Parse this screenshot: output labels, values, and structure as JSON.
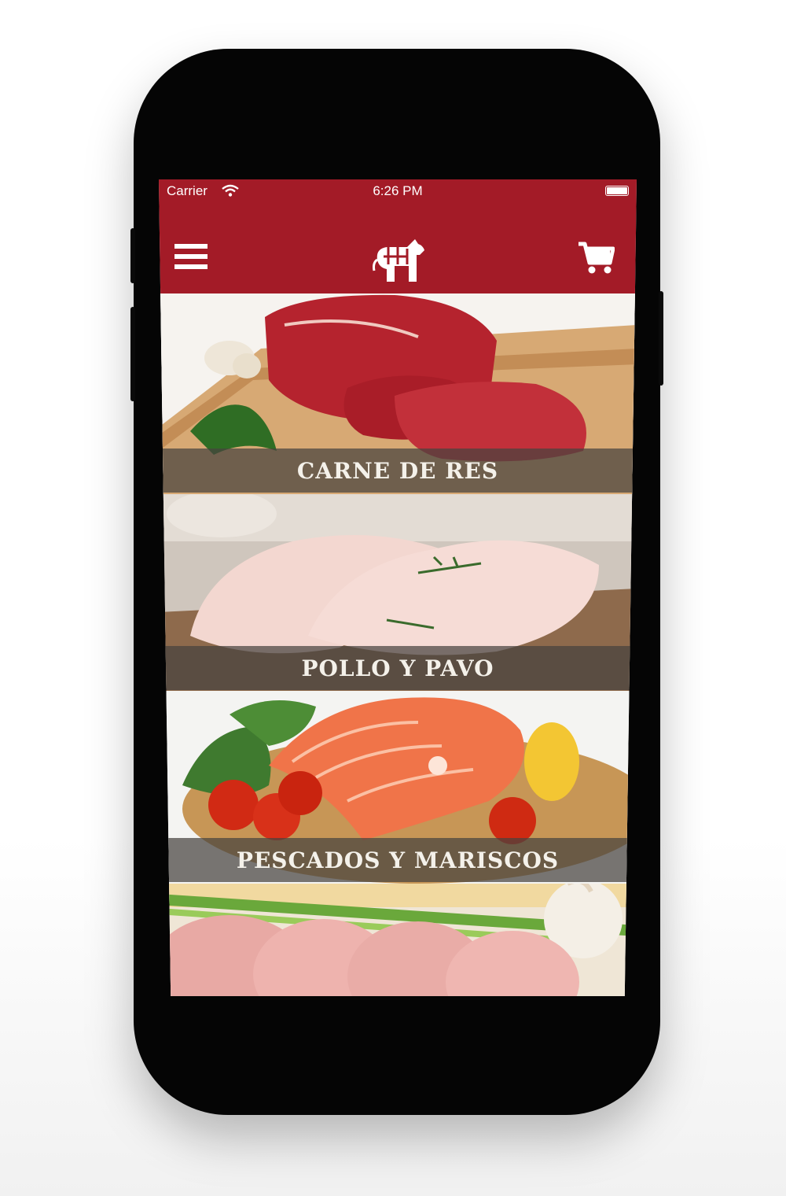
{
  "status_bar": {
    "carrier": "Carrier",
    "time": "6:26 PM",
    "wifi_icon": "wifi-icon",
    "battery_icon": "battery-icon"
  },
  "navbar": {
    "menu_icon": "hamburger-menu-icon",
    "logo_icon": "cow-logo-icon",
    "cart_icon": "shopping-cart-icon",
    "background_color": "#a31b27"
  },
  "categories": [
    {
      "label": "CARNE DE RES",
      "image": "raw beef cuts on cutting board with garlic and parsley"
    },
    {
      "label": "POLLO Y PAVO",
      "image": "raw chicken breasts with rosemary"
    },
    {
      "label": "PESCADOS Y MARISCOS",
      "image": "salmon steaks with tomatoes, basil and lemon"
    },
    {
      "label": "",
      "image": "raw pork chops with green onion and garlic"
    }
  ]
}
